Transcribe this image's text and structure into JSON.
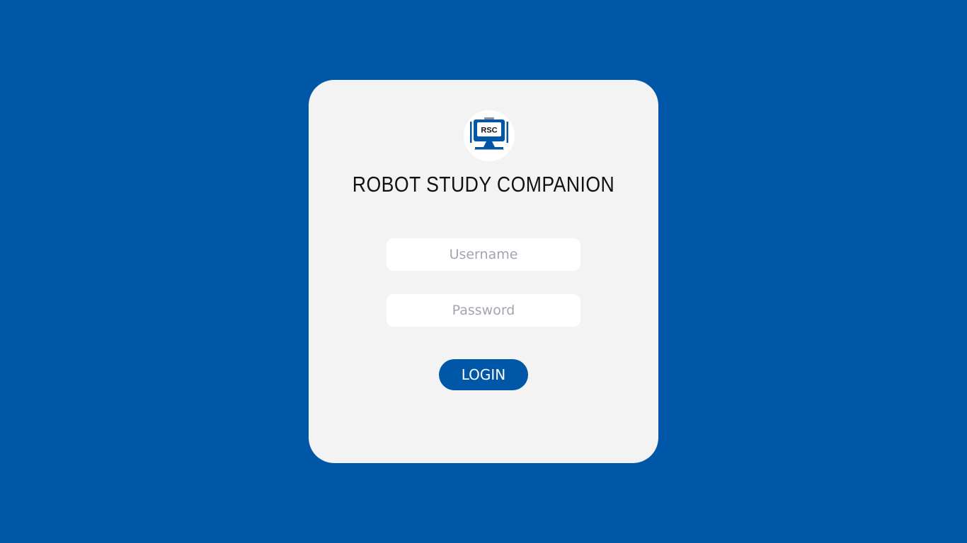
{
  "login": {
    "logo_text": "RSC",
    "title": "ROBOT STUDY COMPANION",
    "username_placeholder": "Username",
    "password_placeholder": "Password",
    "login_label": "LOGIN"
  },
  "colors": {
    "background": "#0057a8",
    "card": "#f3f3f3",
    "accent": "#0057a8"
  },
  "icons": {
    "logo": "robot-monitor-icon"
  }
}
